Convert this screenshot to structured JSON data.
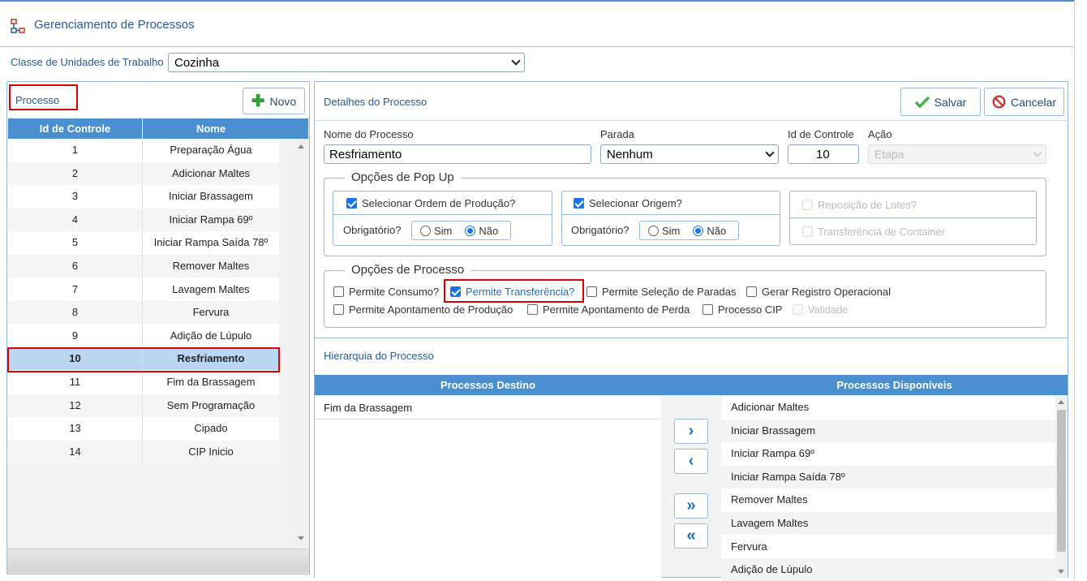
{
  "header": {
    "title": "Gerenciamento de Processos",
    "icon": "process-flow-icon"
  },
  "work_class": {
    "label": "Classe de Unidades de Trabalho",
    "value": "Cozinha"
  },
  "process_list": {
    "title": "Processo",
    "new_label": "Novo",
    "columns": [
      "Id de Controle",
      "Nome"
    ],
    "rows": [
      {
        "id": "1",
        "name": "Preparação Água"
      },
      {
        "id": "2",
        "name": "Adicionar Maltes"
      },
      {
        "id": "3",
        "name": "Iniciar Brassagem"
      },
      {
        "id": "4",
        "name": "Iniciar Rampa 69º"
      },
      {
        "id": "5",
        "name": "Iniciar Rampa Saída 78º"
      },
      {
        "id": "6",
        "name": "Remover Maltes"
      },
      {
        "id": "7",
        "name": "Lavagem Maltes"
      },
      {
        "id": "8",
        "name": "Fervura"
      },
      {
        "id": "9",
        "name": "Adição de Lúpulo"
      },
      {
        "id": "10",
        "name": "Resfriamento"
      },
      {
        "id": "11",
        "name": "Fim da Brassagem"
      },
      {
        "id": "12",
        "name": "Sem Programação"
      },
      {
        "id": "13",
        "name": "Cipado"
      },
      {
        "id": "14",
        "name": "CIP Inicio"
      }
    ],
    "selected_id": "10"
  },
  "details": {
    "title": "Detalhes do Processo",
    "save_label": "Salvar",
    "cancel_label": "Cancelar",
    "name_label": "Nome do Processo",
    "name_value": "Resfriamento",
    "stop_label": "Parada",
    "stop_value": "Nenhum",
    "control_id_label": "Id de Controle",
    "control_id_value": "10",
    "action_label": "Ação",
    "action_value": "Etapa"
  },
  "popup_options": {
    "legend": "Opções de Pop Up",
    "select_order_label": "Selecionar Ordem de Produção?",
    "select_origin_label": "Selecionar Origem?",
    "required_label": "Obrigatório?",
    "yes_label": "Sim",
    "no_label": "Não",
    "lot_replacement_label": "Reposição de Lotes?",
    "container_transfer_label": "Transferência de Container"
  },
  "process_options": {
    "legend": "Opções de Processo",
    "allow_consumption": "Permite Consumo?",
    "allow_transfer": "Permite Transferência?",
    "allow_stop_selection": "Permite Seleção de Paradas",
    "generate_record": "Gerar Registro Operacional",
    "allow_production_entry": "Permite Apontamento de Produção",
    "allow_loss_entry": "Permite Apontamento de Perda",
    "cip_process": "Processo CIP",
    "validity": "Validade"
  },
  "hierarchy": {
    "title": "Hierarquia do Processo",
    "destination_header": "Processos Destino",
    "available_header": "Processos Disponíveis",
    "destination": [
      "Fim da Brassagem"
    ],
    "available": [
      "Adicionar Maltes",
      "Iniciar Brassagem",
      "Iniciar Rampa 69º",
      "Iniciar Rampa Saída 78º",
      "Remover Maltes",
      "Lavagem Maltes",
      "Fervura",
      "Adição de Lúpulo"
    ]
  },
  "colors": {
    "accent": "#4a8fd0",
    "highlight": "#d00000",
    "selected_row": "#b9d6f2"
  }
}
